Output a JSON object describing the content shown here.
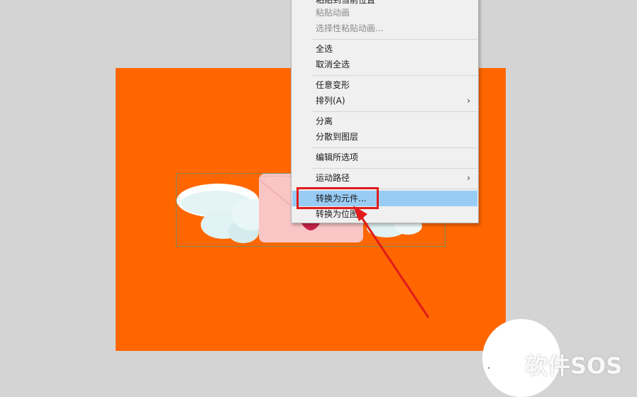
{
  "context_menu": {
    "partial_top_item": "粘贴到当前位置",
    "items": [
      {
        "label": "粘贴动画",
        "disabled": true
      },
      {
        "label": "选择性粘贴动画...",
        "disabled": true
      },
      {
        "label": "全选"
      },
      {
        "label": "取消全选"
      },
      {
        "label": "任意变形"
      },
      {
        "label": "排列(A)",
        "submenu": true
      },
      {
        "label": "分离"
      },
      {
        "label": "分散到图层"
      },
      {
        "label": "编辑所选项"
      },
      {
        "label": "运动路径",
        "submenu": true
      },
      {
        "label": "转换为元件...",
        "highlighted": true
      },
      {
        "label": "转换为位图"
      }
    ],
    "submenu_glyph": "›"
  },
  "colors": {
    "stage": "#ff6600",
    "workspace": "#d4d4d4",
    "menu_bg": "#f0f0f0",
    "menu_highlight": "#99ccf5",
    "annotation_red": "#e01b1b"
  },
  "watermark": {
    "text": "软件SOS"
  }
}
